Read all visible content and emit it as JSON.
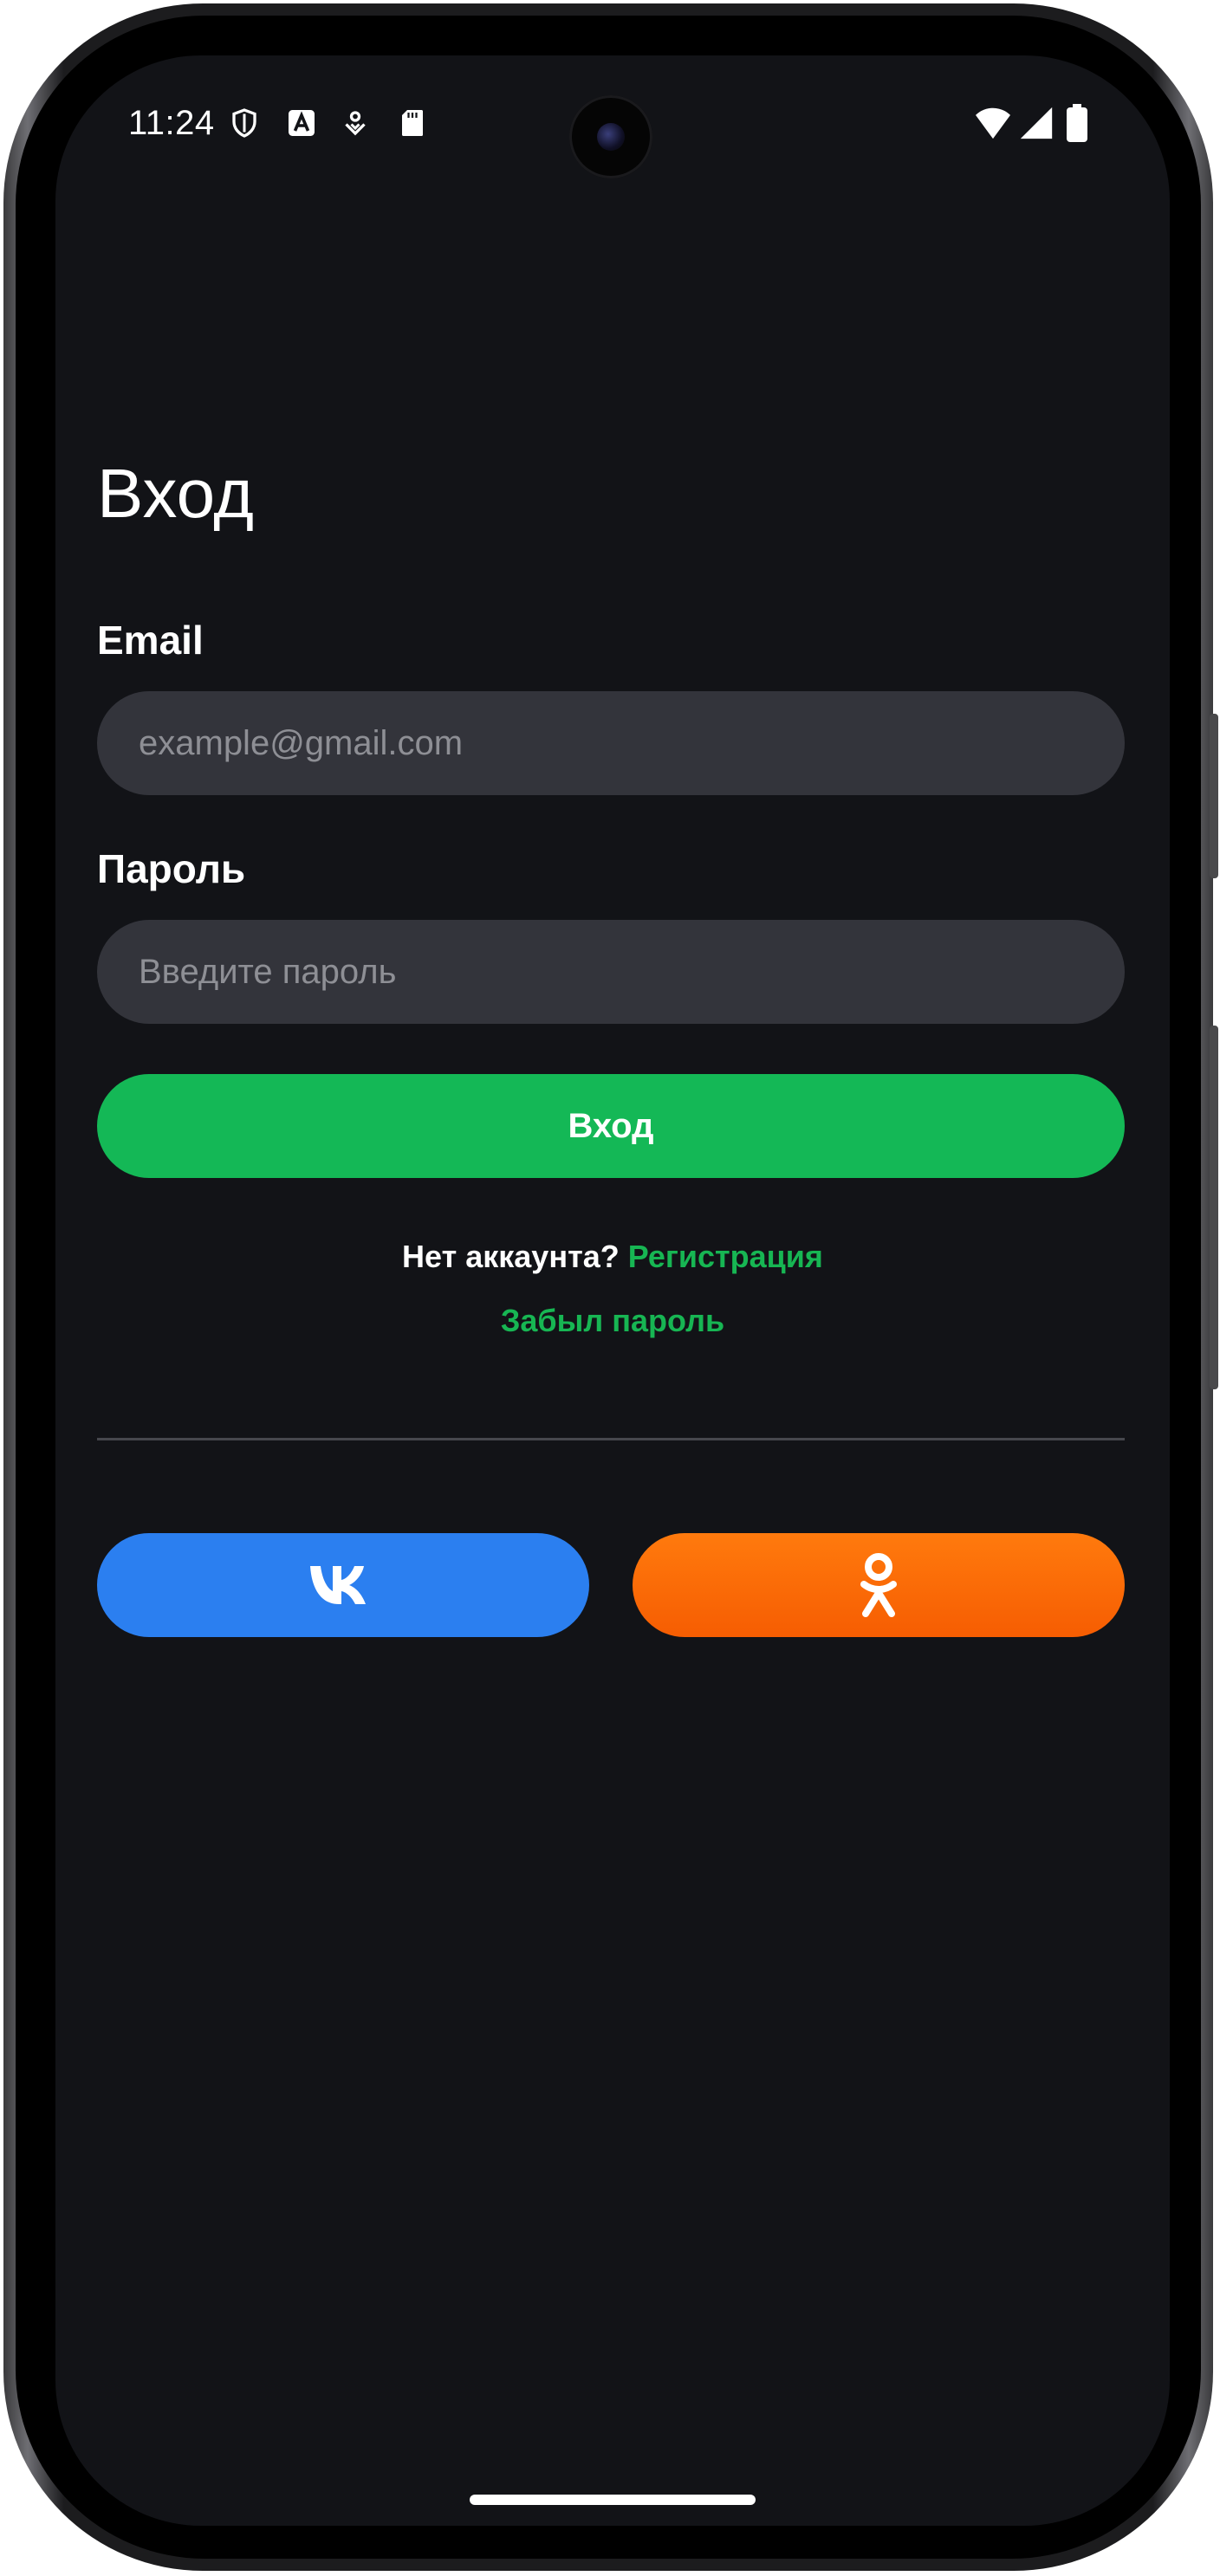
{
  "status_bar": {
    "time": "11:24",
    "left_icons": [
      "shield-icon",
      "font-app-icon",
      "location-icon",
      "sd-card-icon"
    ],
    "right_icons": [
      "wifi-icon",
      "signal-icon",
      "battery-icon"
    ]
  },
  "login": {
    "title": "Вход",
    "email_label": "Email",
    "email_placeholder": "example@gmail.com",
    "email_value": "",
    "password_label": "Пароль",
    "password_placeholder": "Введите пароль",
    "password_value": "",
    "submit_label": "Вход",
    "no_account_text": "Нет аккаунта?",
    "register_link": "Регистрация",
    "forgot_link": "Забыл пароль"
  },
  "social": {
    "vk_icon": "vk-logo-icon",
    "ok_icon": "odnoklassniki-logo-icon"
  },
  "colors": {
    "background": "#121317",
    "input_bg": "#33343b",
    "accent_green": "#14b856",
    "vk_blue": "#2b7ff0",
    "ok_orange": "#ff7a0d"
  }
}
